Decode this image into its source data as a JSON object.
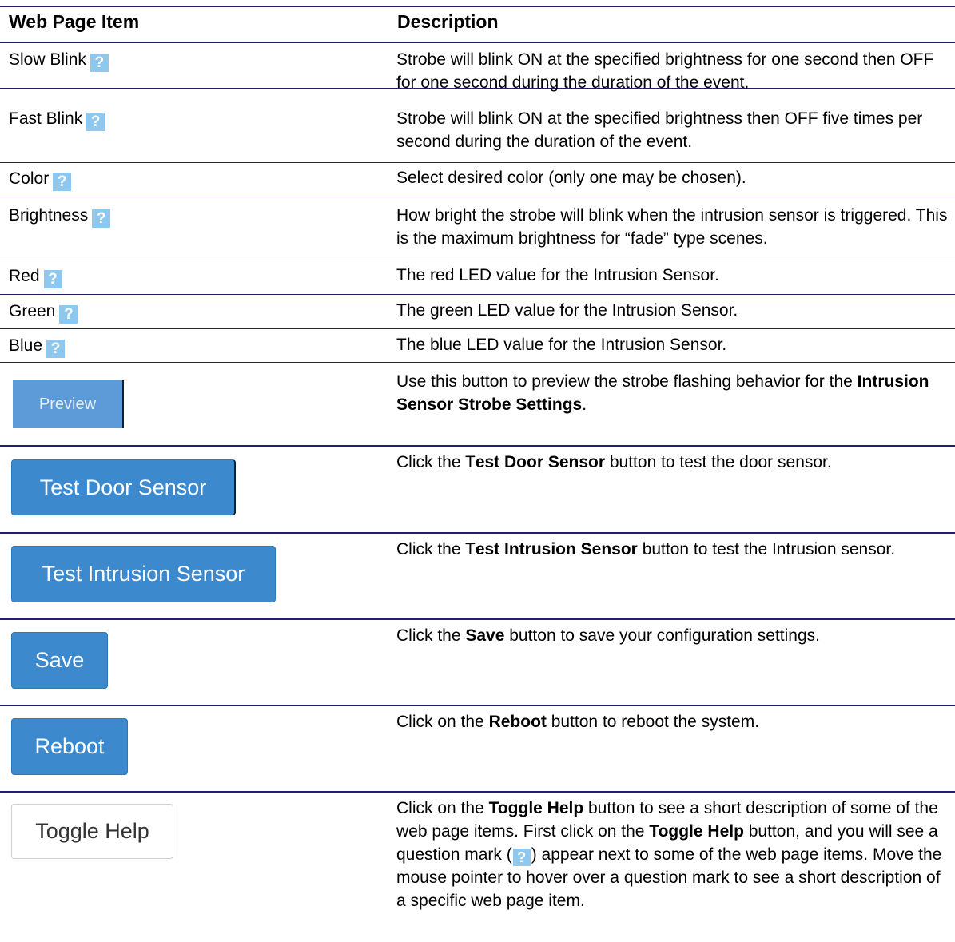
{
  "header": {
    "col_item": "Web Page Item",
    "col_desc": "Description"
  },
  "help_icon_glyph": "?",
  "rows": [
    {
      "item": "Slow Blink",
      "desc": "Strobe will blink ON at the specified brightness for one second then OFF for one second during the duration of the event."
    },
    {
      "item": "Fast Blink",
      "desc": "Strobe will blink ON at the specified brightness then OFF five times per second during the duration of the event."
    },
    {
      "item": "Color",
      "desc": "Select desired color (only one may be chosen)."
    },
    {
      "item": "Brightness",
      "desc": "How bright the strobe will blink when the intrusion sensor is triggered. This is the maximum brightness for “fade” type scenes."
    },
    {
      "item": "Red",
      "desc": "The red LED value for the Intrusion Sensor."
    },
    {
      "item": "Green",
      "desc": "The green LED value for the Intrusion Sensor."
    },
    {
      "item": "Blue",
      "desc": "The blue LED value for the Intrusion Sensor."
    }
  ],
  "preview": {
    "button": "Preview",
    "desc_pre": "Use this button to preview the strobe flashing behavior for the ",
    "desc_bold": "Intrusion Sensor Strobe Settings",
    "desc_post": "."
  },
  "test_door": {
    "button": "Test Door Sensor",
    "desc_pre": "Click the T",
    "desc_bold": "est Door Sensor",
    "desc_post": " button to test the door sensor."
  },
  "test_intrusion": {
    "button": "Test Intrusion Sensor",
    "desc_pre": "Click the T",
    "desc_bold": "est Intrusion Sensor",
    "desc_post": " button to test the Intrusion sensor."
  },
  "save": {
    "button": "Save",
    "desc_pre": "Click the ",
    "desc_bold": "Save",
    "desc_post": " button to save your configuration settings."
  },
  "reboot": {
    "button": "Reboot",
    "desc_pre": "Click on the ",
    "desc_bold": "Reboot",
    "desc_post": " button to reboot the system."
  },
  "toggle": {
    "button": "Toggle Help",
    "desc_1": "Click on the ",
    "desc_bold_1": "Toggle Help",
    "desc_2": " button to see a short description of some of the web page items. First click on the ",
    "desc_bold_2": "Toggle Help",
    "desc_3": " button, and you will see a question mark (",
    "desc_4": ") appear next to some of the web page items. Move the mouse pointer to hover over a question mark to see a short description of a specific web page item."
  },
  "colors": {
    "rule": "#1f1f6b",
    "button_blue": "#3c89ce",
    "help_icon": "#8ec8ef"
  }
}
